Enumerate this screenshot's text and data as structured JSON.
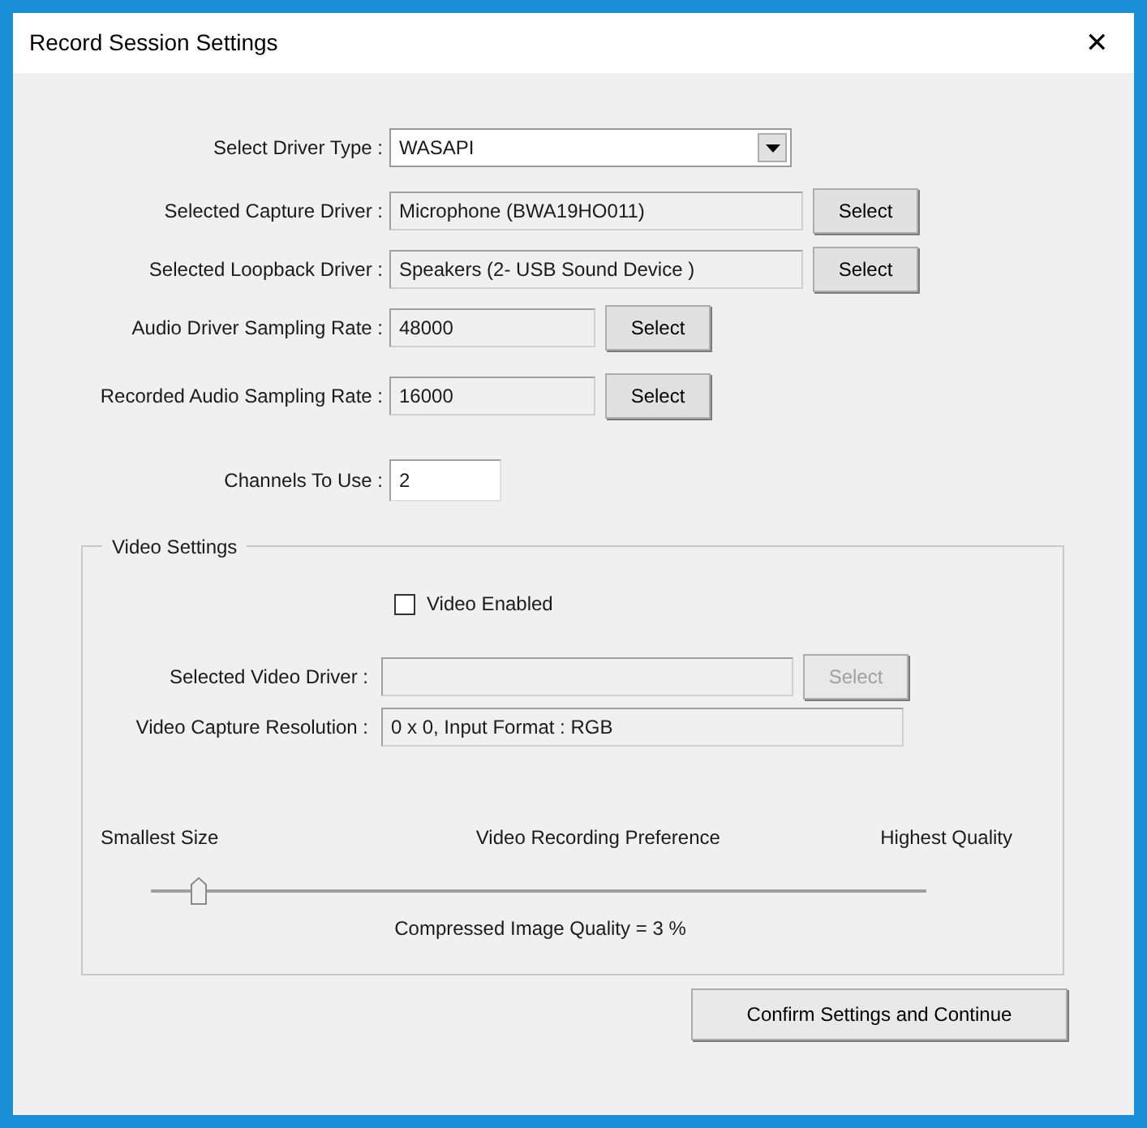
{
  "window": {
    "title": "Record Session Settings",
    "close": "✕"
  },
  "audio_rows": [
    {
      "kind": "dropdown",
      "label": "Select Driver Type :",
      "value": "WASAPI"
    },
    {
      "kind": "field_button",
      "label": "Selected Capture Driver :",
      "value": "Microphone (BWA19HO011)",
      "button": "Select"
    },
    {
      "kind": "field_button",
      "label": "Selected Loopback Driver :",
      "value": "Speakers (2- USB Sound Device )",
      "button": "Select"
    },
    {
      "kind": "short_field_button",
      "label": "Audio Driver Sampling Rate :",
      "value": "48000",
      "button": "Select"
    },
    {
      "kind": "short_field_button",
      "label": "Recorded Audio Sampling Rate :",
      "value": "16000",
      "button": "Select"
    },
    {
      "kind": "input",
      "label": "Channels To Use :",
      "value": "2"
    }
  ],
  "video_settings": {
    "title": "Video Settings",
    "video_enabled": {
      "label": "Video Enabled",
      "checked": false
    },
    "video_driver": {
      "label": "Selected Video Driver :",
      "button": "Select",
      "disabled": true
    },
    "resolution": {
      "label": "Video Capture Resolution :",
      "value": "0 x 0, Input Format : RGB"
    },
    "preference": {
      "min_label": "Smallest Size",
      "title": "Video Recording Preference",
      "max_label": "Highest Quality",
      "level": 0.03,
      "reading": "Compressed Image Quality = 3 %"
    }
  },
  "confirm_button": "Confirm Settings and Continue"
}
